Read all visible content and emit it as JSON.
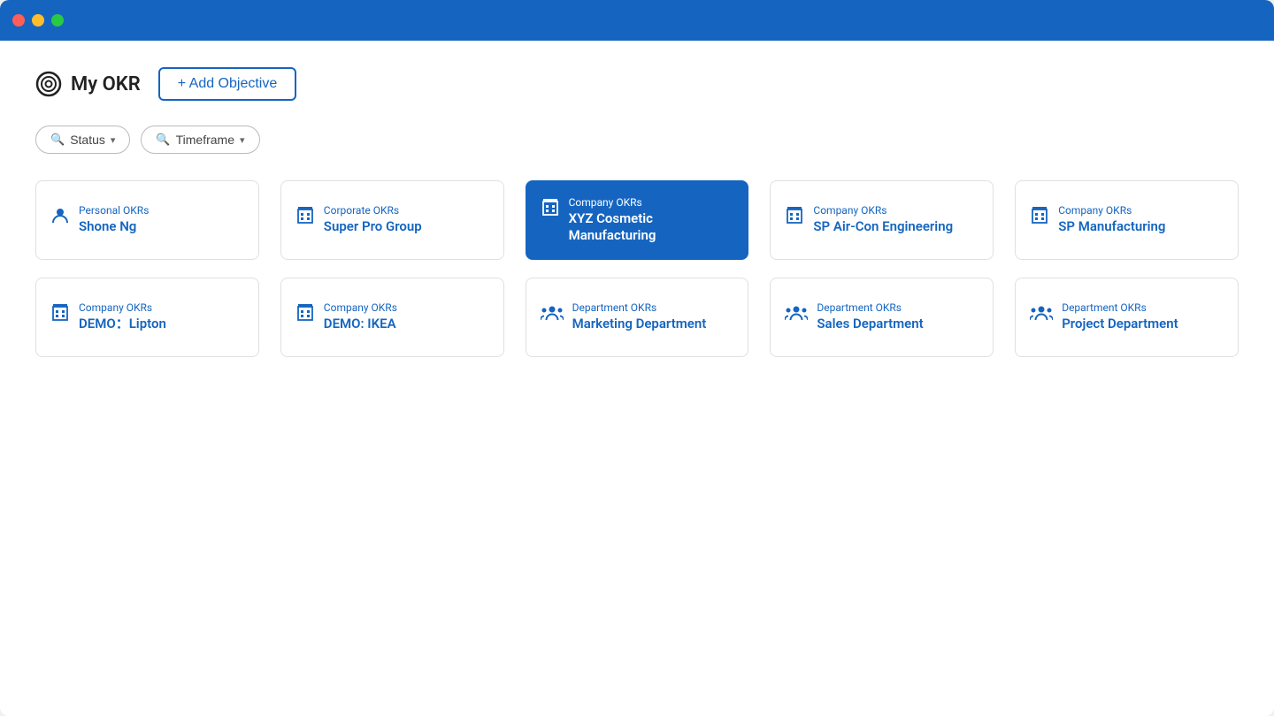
{
  "titleBar": {
    "trafficLights": [
      "red",
      "yellow",
      "green"
    ]
  },
  "header": {
    "iconLabel": "OKR",
    "title": "My OKR",
    "addButton": "+ Add Objective"
  },
  "filters": [
    {
      "id": "status",
      "label": "Status",
      "icon": "🔍"
    },
    {
      "id": "timeframe",
      "label": "Timeframe",
      "icon": "🔍"
    }
  ],
  "cards": [
    {
      "id": "personal-okrs",
      "category": "Personal OKRs",
      "name": "Shone Ng",
      "iconType": "person",
      "active": false
    },
    {
      "id": "corporate-okrs-superprogroup",
      "category": "Corporate OKRs",
      "name": "Super Pro Group",
      "iconType": "building",
      "active": false
    },
    {
      "id": "company-okrs-xyz",
      "category": "Company OKRs",
      "name": "XYZ Cosmetic Manufacturing",
      "iconType": "building",
      "active": true
    },
    {
      "id": "company-okrs-sp-aircon",
      "category": "Company OKRs",
      "name": "SP Air-Con Engineering",
      "iconType": "building",
      "active": false
    },
    {
      "id": "company-okrs-sp-manufacturing",
      "category": "Company OKRs",
      "name": "SP Manufacturing",
      "iconType": "building",
      "active": false
    },
    {
      "id": "company-okrs-demo-lipton",
      "category": "Company OKRs",
      "name": "DEMO：Lipton",
      "iconType": "building",
      "active": false
    },
    {
      "id": "company-okrs-demo-ikea",
      "category": "Company OKRs",
      "name": "DEMO: IKEA",
      "iconType": "building",
      "active": false
    },
    {
      "id": "dept-okrs-marketing",
      "category": "Department OKRs",
      "name": "Marketing Department",
      "iconType": "group",
      "active": false
    },
    {
      "id": "dept-okrs-sales",
      "category": "Department OKRs",
      "name": "Sales Department",
      "iconType": "group",
      "active": false
    },
    {
      "id": "dept-okrs-project",
      "category": "Department OKRs",
      "name": "Project Department",
      "iconType": "group",
      "active": false
    }
  ],
  "colors": {
    "blue": "#1565C0",
    "activeBg": "#1565C0",
    "activeText": "#ffffff",
    "cardText": "#1565C0"
  }
}
